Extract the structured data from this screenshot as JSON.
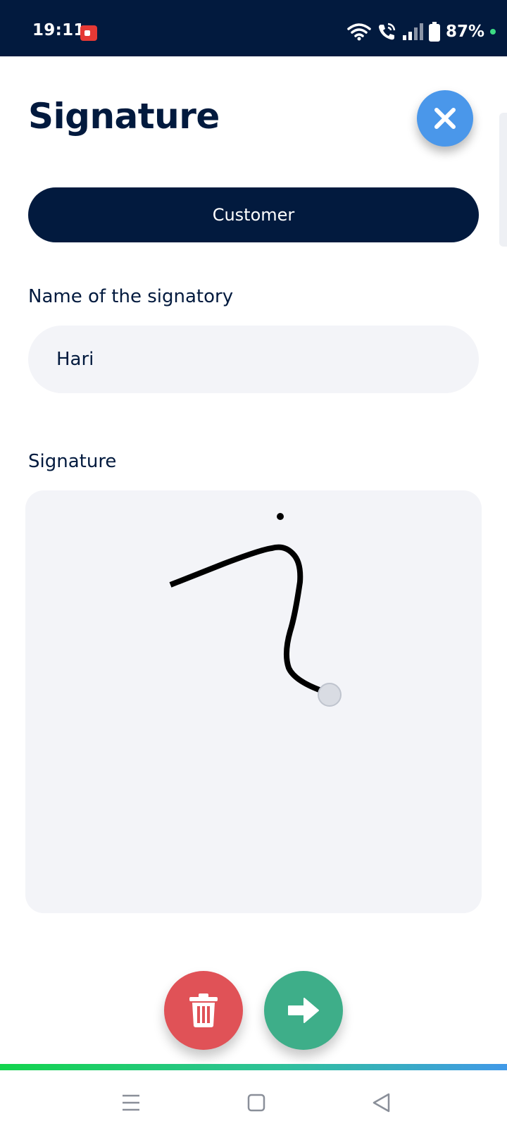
{
  "status_bar": {
    "time": "19:11",
    "battery_percent": "87%",
    "icons": [
      "screen-record-icon",
      "wifi-icon",
      "wifi-call-icon",
      "signal-icon",
      "battery-icon"
    ]
  },
  "page": {
    "title": "Signature"
  },
  "signatory_role": {
    "label": "Customer"
  },
  "name_field": {
    "label": "Name of the signatory",
    "value": "Hari"
  },
  "signature_field": {
    "label": "Signature"
  },
  "actions": {
    "delete_icon": "trash-icon",
    "next_icon": "arrow-right-icon"
  },
  "colors": {
    "navy": "#021a3e",
    "close_blue": "#4a97ea",
    "delete_red": "#e05257",
    "next_green": "#3eae89",
    "field_bg": "#f3f4f8"
  },
  "navigation": {
    "icons": [
      "menu-icon",
      "home-icon",
      "back-icon"
    ]
  }
}
